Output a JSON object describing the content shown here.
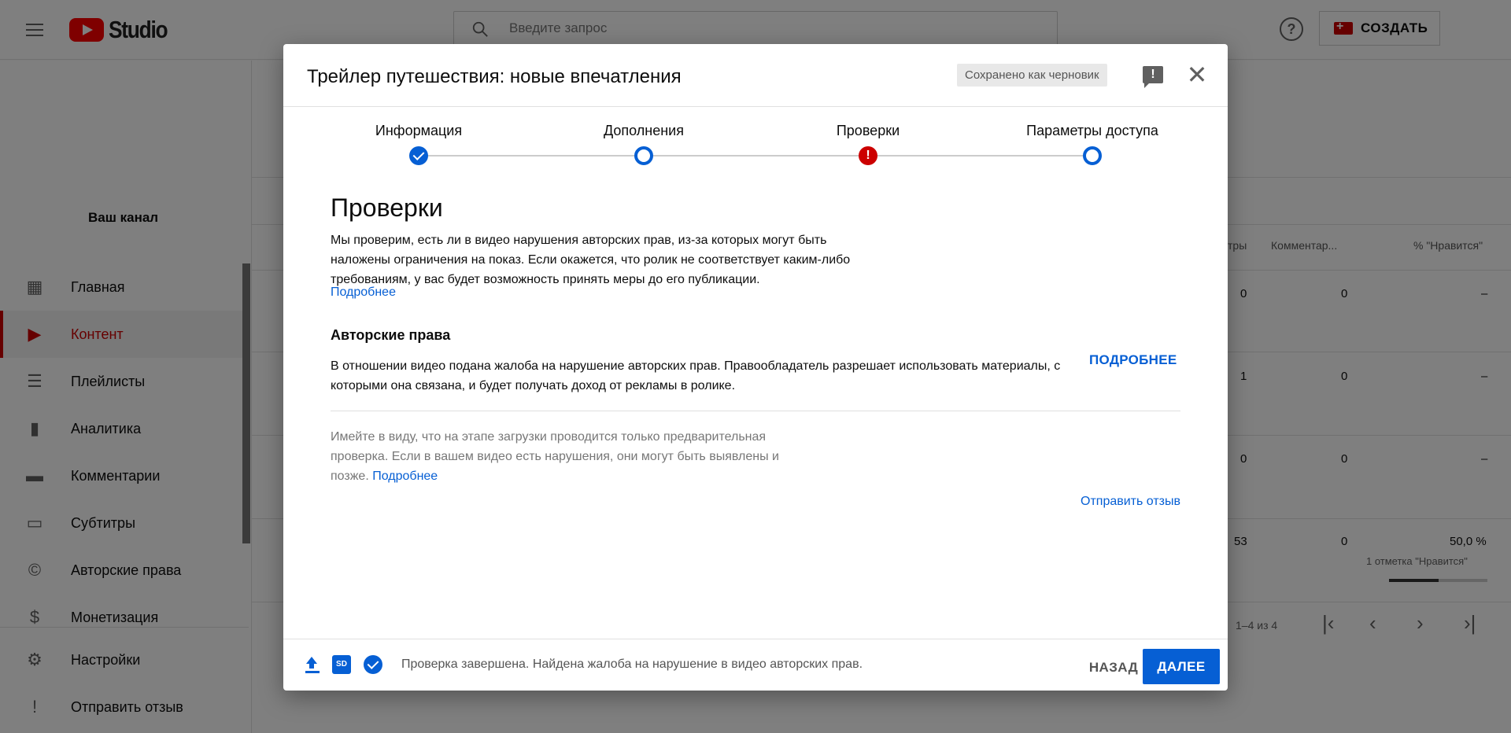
{
  "topbar": {
    "logo_text": "Studio",
    "search_placeholder": "Введите запрос",
    "create_label": "СОЗДАТЬ",
    "help_glyph": "?"
  },
  "sidebar": {
    "channel_label": "Ваш канал",
    "items": [
      {
        "label": "Главная",
        "icon": "dashboard-icon"
      },
      {
        "label": "Контент",
        "icon": "content-icon",
        "active": true
      },
      {
        "label": "Плейлисты",
        "icon": "playlist-icon"
      },
      {
        "label": "Аналитика",
        "icon": "analytics-icon"
      },
      {
        "label": "Комментарии",
        "icon": "comments-icon"
      },
      {
        "label": "Субтитры",
        "icon": "subtitles-icon"
      },
      {
        "label": "Авторские права",
        "icon": "copyright-icon"
      },
      {
        "label": "Монетизация",
        "icon": "dollar-icon"
      },
      {
        "label": "Настройки",
        "icon": "settings-icon"
      },
      {
        "label": "Отправить отзыв",
        "icon": "feedback-icon"
      }
    ]
  },
  "table": {
    "headers": {
      "views_partial": "тры",
      "comments": "Комментар...",
      "likes": "% \"Нравится\""
    },
    "rows": [
      {
        "views": "0",
        "comments": "0",
        "likes": "–"
      },
      {
        "views": "1",
        "comments": "0",
        "likes": "–"
      },
      {
        "views": "0",
        "comments": "0",
        "likes": "–"
      },
      {
        "views": "53",
        "comments": "0",
        "likes": "50,0 %",
        "likes_note": "1 отметка \"Нравится\"",
        "likes_share": 0.5
      }
    ],
    "pagination": "1–4 из 4"
  },
  "dialog": {
    "title": "Трейлер путешествия: новые впечатления",
    "draft_badge": "Сохранено как черновик",
    "steps": [
      {
        "label": "Информация",
        "state": "done"
      },
      {
        "label": "Дополнения",
        "state": "open"
      },
      {
        "label": "Проверки",
        "state": "error",
        "glyph": "!"
      },
      {
        "label": "Параметры доступа",
        "state": "open"
      }
    ],
    "section_title": "Проверки",
    "section_desc": "Мы проверим, есть ли в видео нарушения авторских прав, из-за которых могут быть наложены ограничения на показ. Если окажется, что ролик не соответствует каким-либо требованиям, у вас будет возможность принять меры до его публикации.",
    "section_link": "Подробнее",
    "copyright_title": "Авторские права",
    "copyright_text": "В отношении видео подана жалоба на нарушение авторских прав. Правообладатель разрешает использовать материалы, с которыми она связана, и будет получать доход от рекламы в ролике.",
    "copyright_more": "ПОДРОБНЕЕ",
    "note_text": "Имейте в виду, что на этапе загрузки проводится только предварительная проверка. Если в вашем видео есть нарушения, они могут быть выявлены и позже.",
    "note_link": "Подробнее",
    "send_feedback": "Отправить отзыв",
    "footer": {
      "sd_badge": "SD",
      "status": "Проверка завершена. Найдена жалоба на нарушение в видео авторских прав.",
      "back": "НАЗАД",
      "next": "ДАЛЕЕ"
    }
  },
  "colors": {
    "accent": "#065fd4",
    "error": "#cc0000",
    "brand": "#ff0000"
  }
}
